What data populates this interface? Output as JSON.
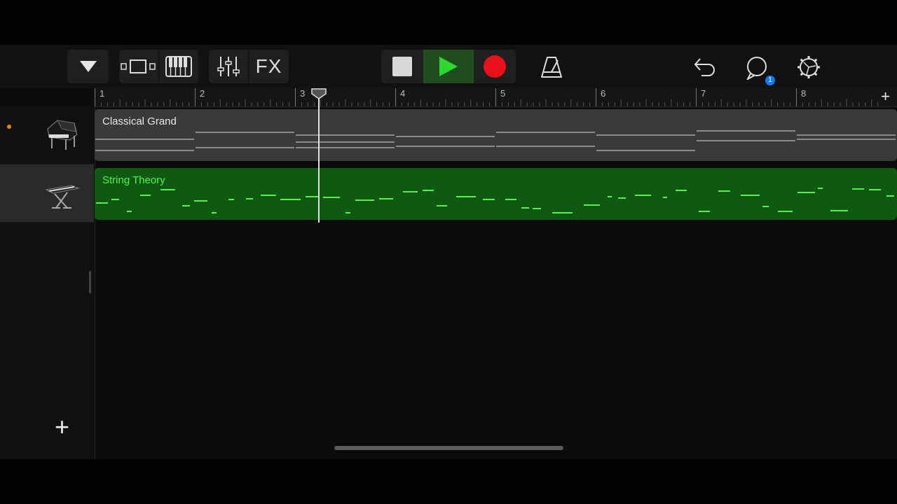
{
  "toolbar": {
    "menu_icon": "triangle-down-icon",
    "tracks_view_icon": "tracks-view-icon",
    "keyboard_icon": "keyboard-icon",
    "mixer_icon": "mixer-sliders-icon",
    "fx_label": "FX",
    "stop_icon": "stop-icon",
    "play_icon": "play-icon",
    "record_icon": "record-icon",
    "metronome_icon": "metronome-icon",
    "undo_icon": "undo-icon",
    "loop_icon": "loop-browser-icon",
    "loop_badge": "1",
    "settings_icon": "settings-gear-icon"
  },
  "ruler": {
    "bars": [
      "1",
      "2",
      "3",
      "4",
      "5",
      "6",
      "7",
      "8"
    ],
    "add_label": "+"
  },
  "tracks": [
    {
      "name": "Classical Grand",
      "icon": "grand-piano-icon",
      "armed": true
    },
    {
      "name": "String Theory",
      "icon": "keyboard-stand-icon",
      "selected": true
    }
  ],
  "add_track_label": "+",
  "colors": {
    "play_active": "#1f4d1f",
    "play_triangle": "#2fd82f",
    "record": "#e8101a",
    "region_gray": "#3a3a3a",
    "region_green": "#0f5a12",
    "note_green": "#57f24d",
    "badge_blue": "#1479ff"
  }
}
